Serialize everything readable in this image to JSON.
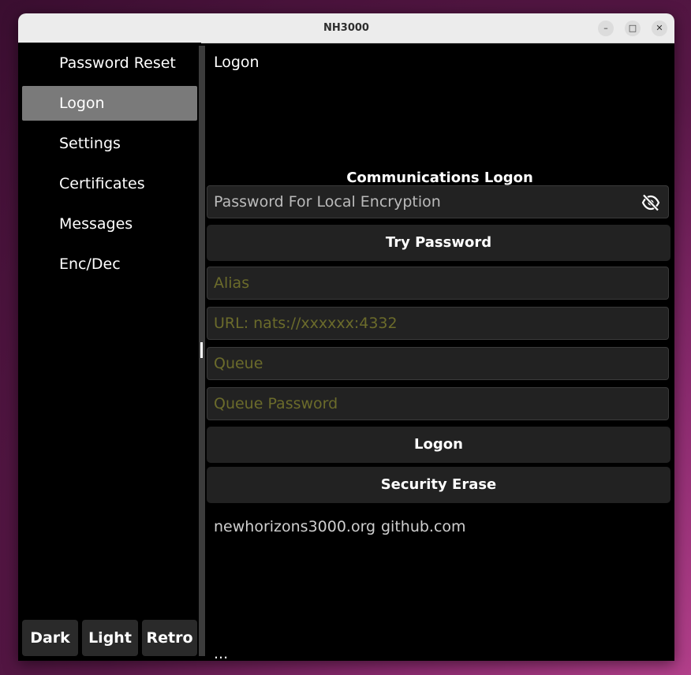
{
  "window": {
    "title": "NH3000",
    "minimize_glyph": "–",
    "maximize_glyph": "□",
    "close_glyph": "✕"
  },
  "sidebar": {
    "items": [
      {
        "label": "Password Reset"
      },
      {
        "label": "Logon",
        "active": true
      },
      {
        "label": "Settings"
      },
      {
        "label": "Certificates"
      },
      {
        "label": "Messages"
      },
      {
        "label": "Enc/Dec"
      }
    ],
    "theme_buttons": {
      "dark": "Dark",
      "light": "Light",
      "retro": "Retro"
    }
  },
  "main": {
    "page_title": "Logon",
    "section_title": "Communications Logon",
    "password_placeholder": "Password For Local Encryption",
    "try_password_label": "Try Password",
    "alias_placeholder": "Alias",
    "url_placeholder": "URL: nats://xxxxxx:4332",
    "queue_placeholder": "Queue",
    "queue_password_placeholder": "Queue Password",
    "logon_label": "Logon",
    "security_erase_label": "Security Erase",
    "links": [
      {
        "text": "newhorizons3000.org"
      },
      {
        "text": "github.com"
      }
    ],
    "footer_text": "..."
  },
  "colors": {
    "window_bg": "#000000",
    "active_item": "#7a7a7a",
    "button_bg": "#222222",
    "placeholder": "#6b6b2b",
    "text": "#ffffff"
  },
  "icons": {
    "password_visibility": "eye-slash-icon"
  }
}
